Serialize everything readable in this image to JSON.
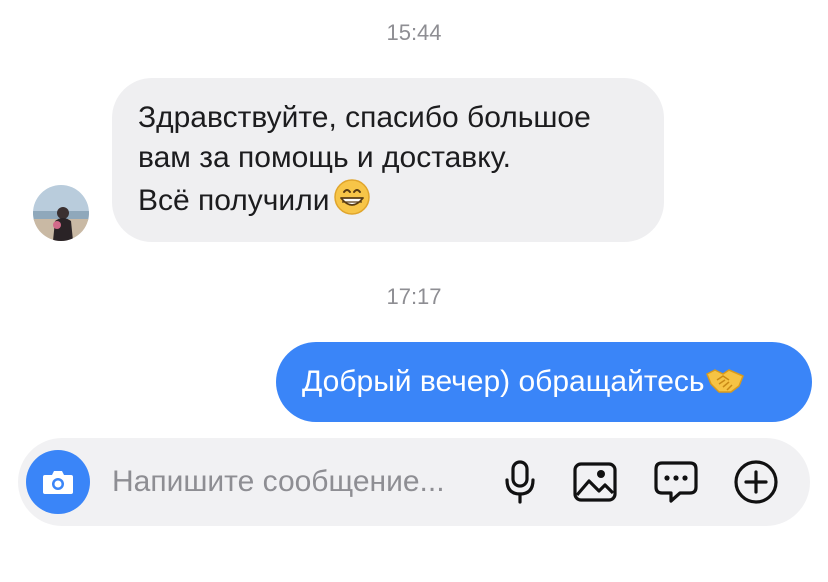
{
  "timestamps": [
    "15:44",
    "17:17"
  ],
  "incoming_message": {
    "lines": [
      "Здравствуйте, спасибо большое",
      "вам за помощь и доставку.",
      "Всё получили"
    ],
    "emoji": "grinning-face"
  },
  "outgoing_message": {
    "text": "Добрый вечер) обращайтесь",
    "emoji": "handshake"
  },
  "composer": {
    "placeholder": "Напишите сообщение..."
  },
  "colors": {
    "accent": "#3a85f8",
    "incoming_bubble": "#efeff1",
    "composer_bg": "#f1f1f3",
    "muted_text": "#8e8e93"
  },
  "icons": [
    "camera-icon",
    "microphone-icon",
    "image-icon",
    "chat-bubble-icon",
    "plus-icon"
  ]
}
